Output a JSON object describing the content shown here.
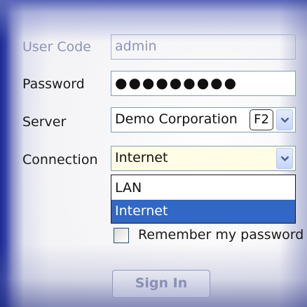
{
  "login": {
    "user_code_label": "User Code",
    "user_code_value": "admin",
    "password_label": "Password",
    "password_value": "●●●●●●●●●",
    "server_label": "Server",
    "server_value": "Demo Corporation",
    "server_hotkey": "F2",
    "connection_label": "Connection",
    "connection_value": "Internet",
    "connection_options": [
      "LAN",
      "Internet"
    ],
    "remember_label": "Remember my password",
    "remember_checked": false,
    "sign_in_label": "Sign In"
  },
  "colors": {
    "selection_blue": "#3167c5",
    "field_border": "#7f9db9",
    "active_field_bg": "#fffde5",
    "side_gradient_blue": "#1b2b8e"
  },
  "icons": {
    "dropdown_arrow": "chevron-down-icon"
  }
}
